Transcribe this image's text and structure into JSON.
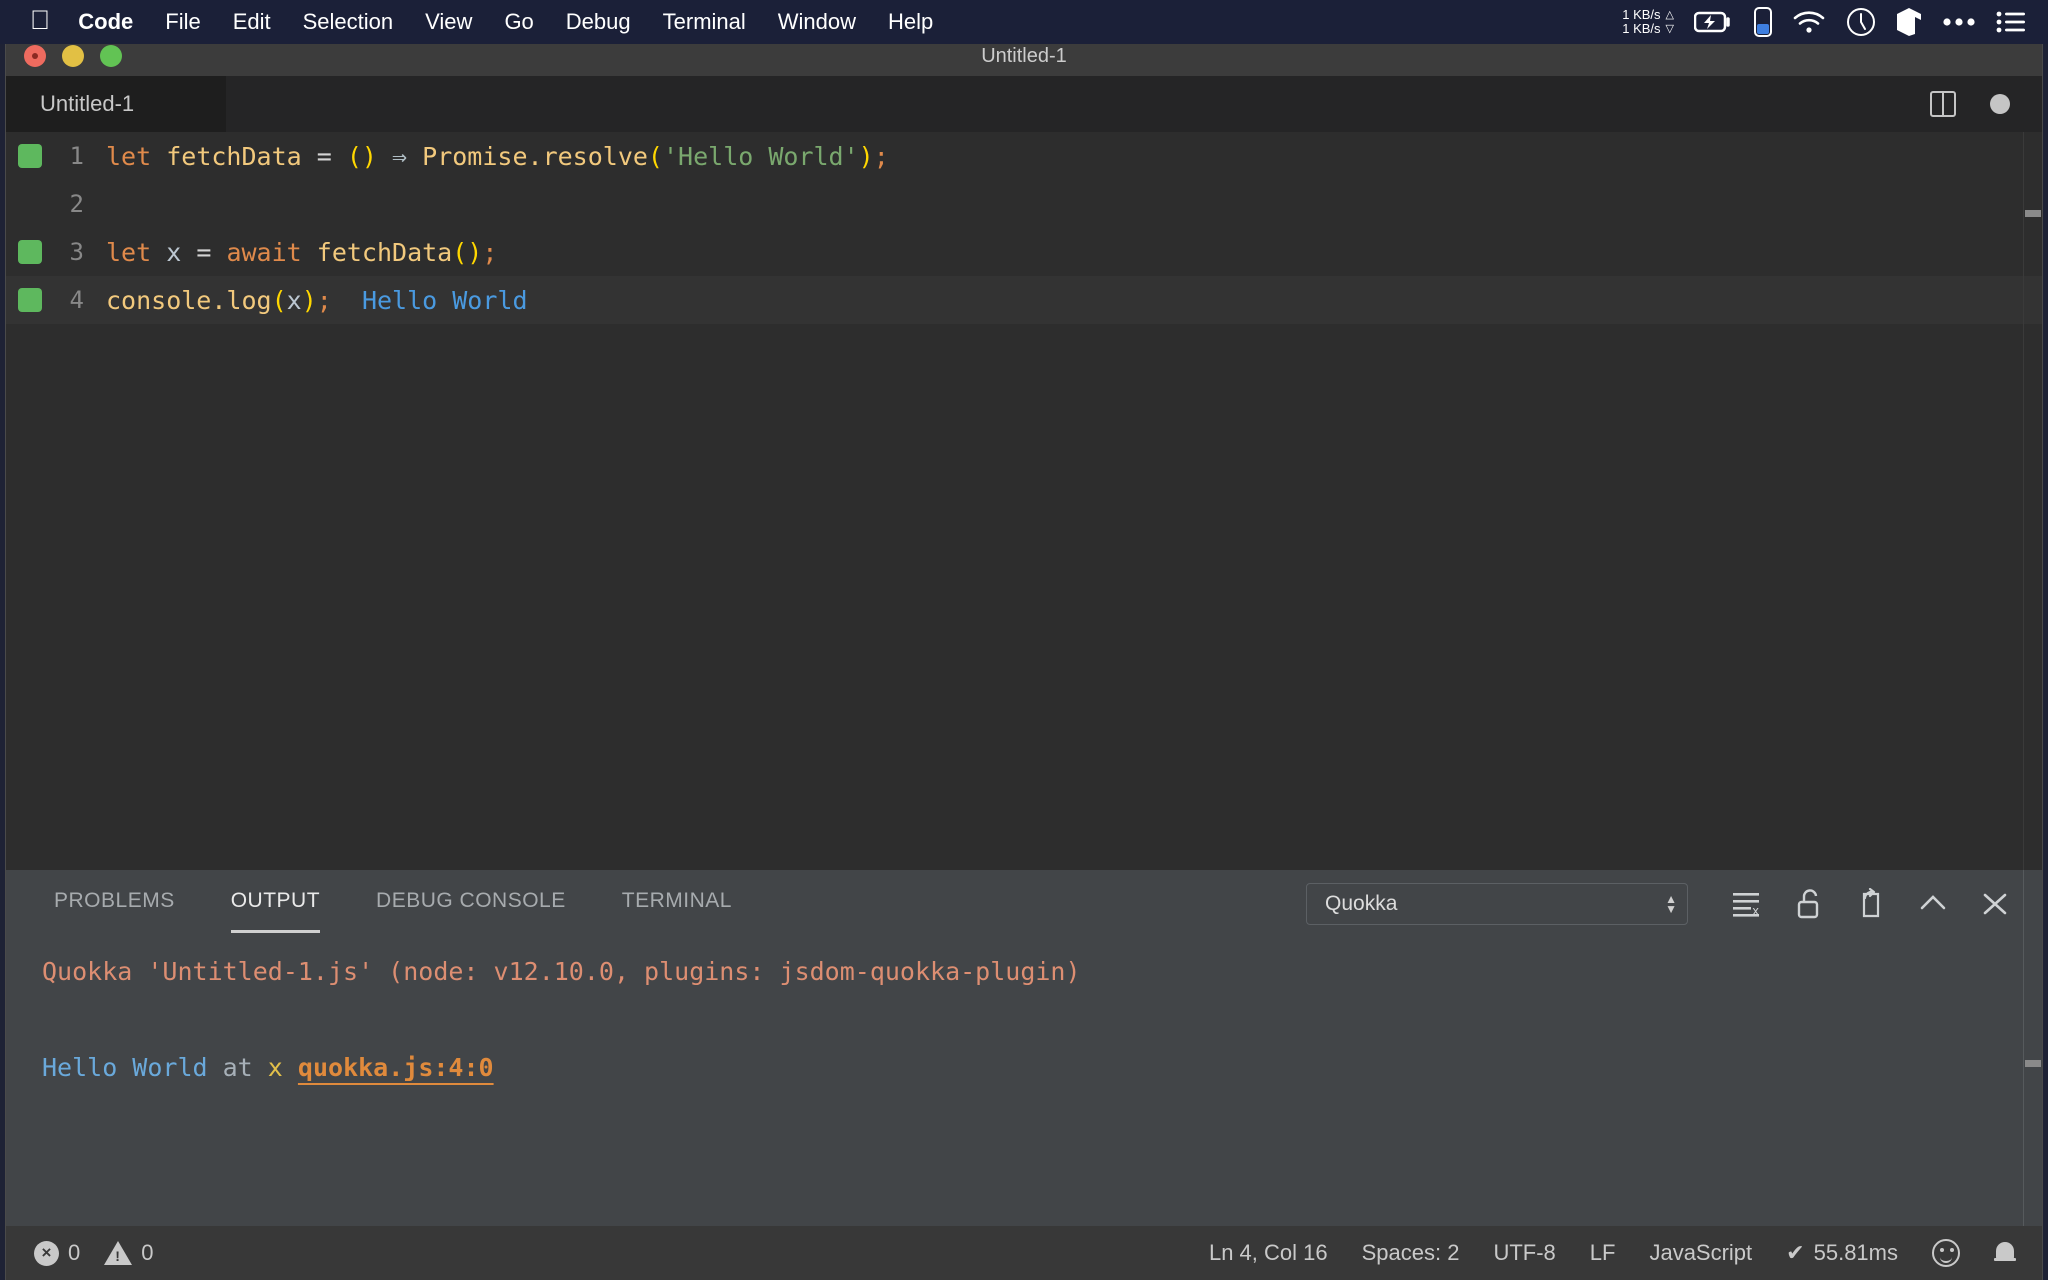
{
  "menubar": {
    "apple_icon": "apple-logo-icon",
    "items": [
      {
        "label": "Code",
        "bold": true
      },
      {
        "label": "File",
        "bold": false
      },
      {
        "label": "Edit",
        "bold": false
      },
      {
        "label": "Selection",
        "bold": false
      },
      {
        "label": "View",
        "bold": false
      },
      {
        "label": "Go",
        "bold": false
      },
      {
        "label": "Debug",
        "bold": false
      },
      {
        "label": "Terminal",
        "bold": false
      },
      {
        "label": "Window",
        "bold": false
      },
      {
        "label": "Help",
        "bold": false
      }
    ],
    "network": {
      "upload": "1 KB/s",
      "download": "1 KB/s",
      "up_arrow": "△",
      "down_arrow": "▽"
    },
    "status_icons": [
      "battery-charging-icon",
      "device-battery-icon",
      "wifi-icon",
      "clock-icon",
      "cube-icon",
      "ellipsis-icon",
      "control-center-icon"
    ]
  },
  "window": {
    "title": "Untitled-1",
    "traffic_lights": [
      "close-button",
      "minimize-button",
      "maximize-button"
    ]
  },
  "editor_tabs": {
    "tabs": [
      {
        "label": "Untitled-1",
        "active": true
      }
    ],
    "actions": [
      "split-editor-icon",
      "unsaved-dot-icon"
    ]
  },
  "code": {
    "lines": [
      {
        "number": "1",
        "marker": true,
        "highlight": false,
        "tokens": [
          {
            "text": "let",
            "cls": "t-key"
          },
          {
            "text": " ",
            "cls": "t-plain"
          },
          {
            "text": "fetchData",
            "cls": "t-fn"
          },
          {
            "text": " = ",
            "cls": "t-op"
          },
          {
            "text": "()",
            "cls": "t-paren"
          },
          {
            "text": " ",
            "cls": "t-plain"
          },
          {
            "text": "⇒",
            "cls": "t-arrow"
          },
          {
            "text": " ",
            "cls": "t-plain"
          },
          {
            "text": "Promise",
            "cls": "t-prop"
          },
          {
            "text": ".",
            "cls": "t-prop"
          },
          {
            "text": "resolve",
            "cls": "t-prop"
          },
          {
            "text": "(",
            "cls": "t-paren"
          },
          {
            "text": "'Hello World'",
            "cls": "t-str"
          },
          {
            "text": ")",
            "cls": "t-paren"
          },
          {
            "text": ";",
            "cls": "t-semi"
          }
        ]
      },
      {
        "number": "2",
        "marker": false,
        "highlight": false,
        "tokens": []
      },
      {
        "number": "3",
        "marker": true,
        "highlight": false,
        "tokens": [
          {
            "text": "let",
            "cls": "t-key"
          },
          {
            "text": " ",
            "cls": "t-plain"
          },
          {
            "text": "x",
            "cls": "t-var"
          },
          {
            "text": " = ",
            "cls": "t-op"
          },
          {
            "text": "await",
            "cls": "t-key"
          },
          {
            "text": " ",
            "cls": "t-plain"
          },
          {
            "text": "fetchData",
            "cls": "t-fn"
          },
          {
            "text": "()",
            "cls": "t-paren"
          },
          {
            "text": ";",
            "cls": "t-semi"
          }
        ]
      },
      {
        "number": "4",
        "marker": true,
        "highlight": true,
        "tokens": [
          {
            "text": "console",
            "cls": "t-fn"
          },
          {
            "text": ".",
            "cls": "t-fn"
          },
          {
            "text": "log",
            "cls": "t-fn"
          },
          {
            "text": "(",
            "cls": "t-paren"
          },
          {
            "text": "x",
            "cls": "t-var"
          },
          {
            "text": ")",
            "cls": "t-paren"
          },
          {
            "text": ";",
            "cls": "t-semi"
          },
          {
            "text": "  ",
            "cls": "t-plain"
          },
          {
            "text": "Hello World",
            "cls": "t-val"
          }
        ]
      }
    ]
  },
  "panel": {
    "tabs": [
      {
        "label": "PROBLEMS",
        "active": false
      },
      {
        "label": "OUTPUT",
        "active": true
      },
      {
        "label": "DEBUG CONSOLE",
        "active": false
      },
      {
        "label": "TERMINAL",
        "active": false
      }
    ],
    "channel_select": {
      "value": "Quokka",
      "up_arrow": "▲",
      "down_arrow": "▼"
    },
    "actions": [
      "clear-output-icon",
      "unlock-icon",
      "open-in-editor-icon",
      "maximize-panel-icon",
      "close-panel-icon"
    ],
    "output_lines": [
      {
        "segments": [
          {
            "text": "Quokka 'Untitled-1.js' (node: v12.10.0, plugins: jsdom-quokka-plugin)",
            "cls": "o-head"
          }
        ]
      },
      {
        "segments": []
      },
      {
        "segments": [
          {
            "text": "Hello World",
            "cls": "o-blue"
          },
          {
            "text": " at ",
            "cls": "o-grey"
          },
          {
            "text": "x",
            "cls": "o-yellow"
          },
          {
            "text": " ",
            "cls": "o-grey"
          },
          {
            "text": "quokka.js:4:0",
            "cls": "o-link"
          }
        ]
      }
    ]
  },
  "statusbar": {
    "errors": "0",
    "warnings": "0",
    "cursor": "Ln 4, Col 16",
    "indentation": "Spaces: 2",
    "encoding": "UTF-8",
    "eol": "LF",
    "language": "JavaScript",
    "quokka_time": "55.81ms",
    "quokka_check": "✔",
    "right_icons": [
      "feedback-smiley-icon",
      "notifications-bell-icon"
    ]
  },
  "colors": {
    "menubar_bg": "#1b2038",
    "titlebar_bg": "#3c3c3c",
    "editor_bg": "#2d2d2d",
    "panel_bg": "#424548",
    "statusbar_bg": "#383838",
    "quokka_marker": "#5eb85e",
    "accent_link": "#e08a3c"
  }
}
